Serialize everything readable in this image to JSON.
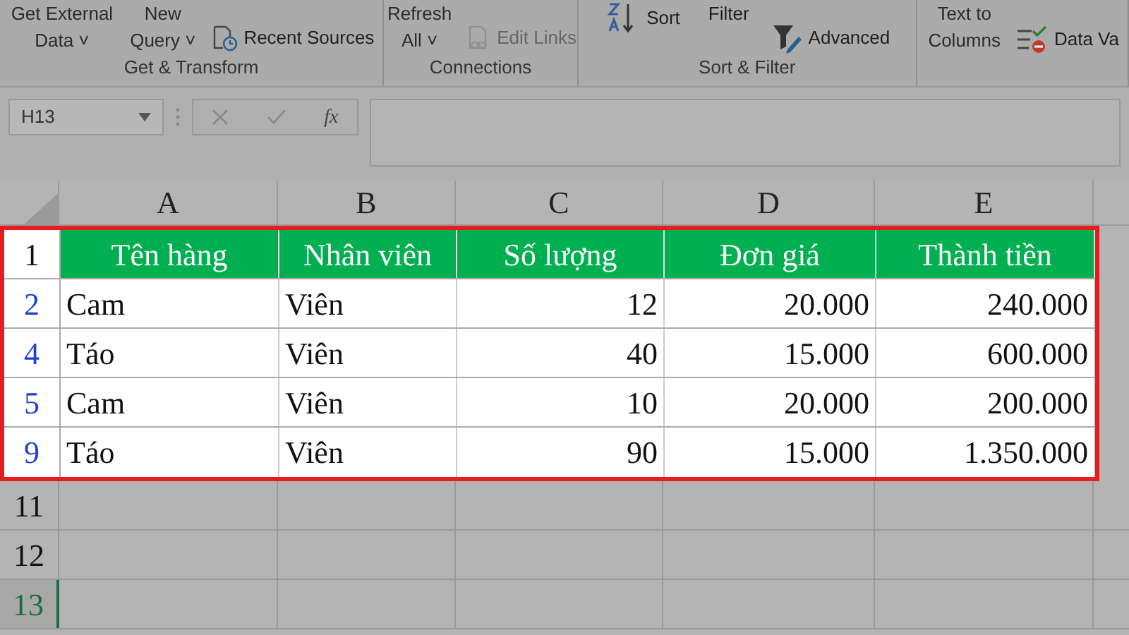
{
  "ribbon": {
    "groups": [
      {
        "label": "Get & Transform",
        "items": [
          {
            "kind": "big",
            "lines": [
              "Get External",
              "Data ˅"
            ]
          },
          {
            "kind": "big",
            "lines": [
              "New",
              "Query ˅"
            ]
          },
          {
            "kind": "small",
            "text": "Recent Sources",
            "disabled": false
          }
        ]
      },
      {
        "label": "Connections",
        "items": [
          {
            "kind": "big",
            "lines": [
              "Refresh",
              "All ˅"
            ]
          },
          {
            "kind": "small",
            "text": "Edit Links",
            "disabled": true
          }
        ]
      },
      {
        "label": "Sort & Filter",
        "items": [
          {
            "kind": "small",
            "text": "Sort",
            "disabled": false
          },
          {
            "kind": "small",
            "text": "Filter",
            "disabled": false
          },
          {
            "kind": "small",
            "text": "Advanced",
            "disabled": false
          }
        ]
      },
      {
        "items": [
          {
            "kind": "big",
            "lines": [
              "Text to",
              "Columns"
            ]
          },
          {
            "kind": "small",
            "text": "Data Va",
            "disabled": false
          }
        ]
      }
    ]
  },
  "formula_bar": {
    "name_box": "H13",
    "fx": "fx"
  },
  "columns": [
    {
      "letter": "A",
      "kind": "text"
    },
    {
      "letter": "B",
      "kind": "text"
    },
    {
      "letter": "C",
      "kind": "number"
    },
    {
      "letter": "D",
      "kind": "number"
    },
    {
      "letter": "E",
      "kind": "number"
    }
  ],
  "table": {
    "header": {
      "number": "1",
      "cells": [
        "Tên hàng",
        "Nhân viên",
        "Số lượng",
        "Đơn giá",
        "Thành tiền"
      ]
    },
    "rows": [
      {
        "number": "2",
        "filtered": true,
        "cells": [
          "Cam",
          "Viên",
          "12",
          "20.000",
          "240.000"
        ]
      },
      {
        "number": "4",
        "filtered": true,
        "cells": [
          "Táo",
          "Viên",
          "40",
          "15.000",
          "600.000"
        ]
      },
      {
        "number": "5",
        "filtered": true,
        "cells": [
          "Cam",
          "Viên",
          "10",
          "20.000",
          "200.000"
        ]
      },
      {
        "number": "9",
        "filtered": true,
        "cells": [
          "Táo",
          "Viên",
          "90",
          "15.000",
          "1.350.000"
        ]
      }
    ]
  },
  "empty_rows": [
    {
      "number": "11",
      "selected": false
    },
    {
      "number": "12",
      "selected": false
    },
    {
      "number": "13",
      "selected": true
    }
  ]
}
